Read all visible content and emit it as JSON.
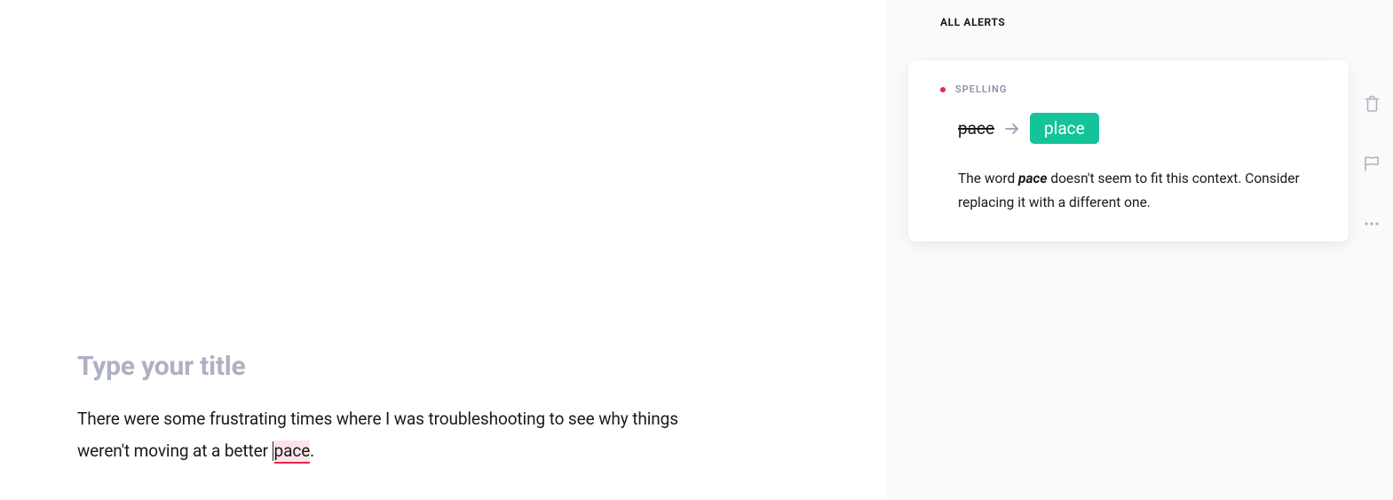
{
  "editor": {
    "title_placeholder": "Type your title",
    "body_before": "There were some frustrating times where I was troubleshooting to see why things weren't moving at a better ",
    "flagged_word": "pace",
    "body_after": "."
  },
  "panel": {
    "header": "ALL ALERTS"
  },
  "alert": {
    "category": "SPELLING",
    "original": "pace",
    "suggestion": "place",
    "explanation_before": "The word ",
    "explanation_em": "pace",
    "explanation_after": " doesn't seem to fit this context. Consider replacing it with a different one."
  },
  "icons": {
    "trash": "trash-icon",
    "flag": "flag-icon",
    "more": "more-icon",
    "arrow": "arrow-right-icon"
  },
  "colors": {
    "accent_red": "#e5294b",
    "accent_green": "#15c39a",
    "muted": "#aeb1bf"
  }
}
